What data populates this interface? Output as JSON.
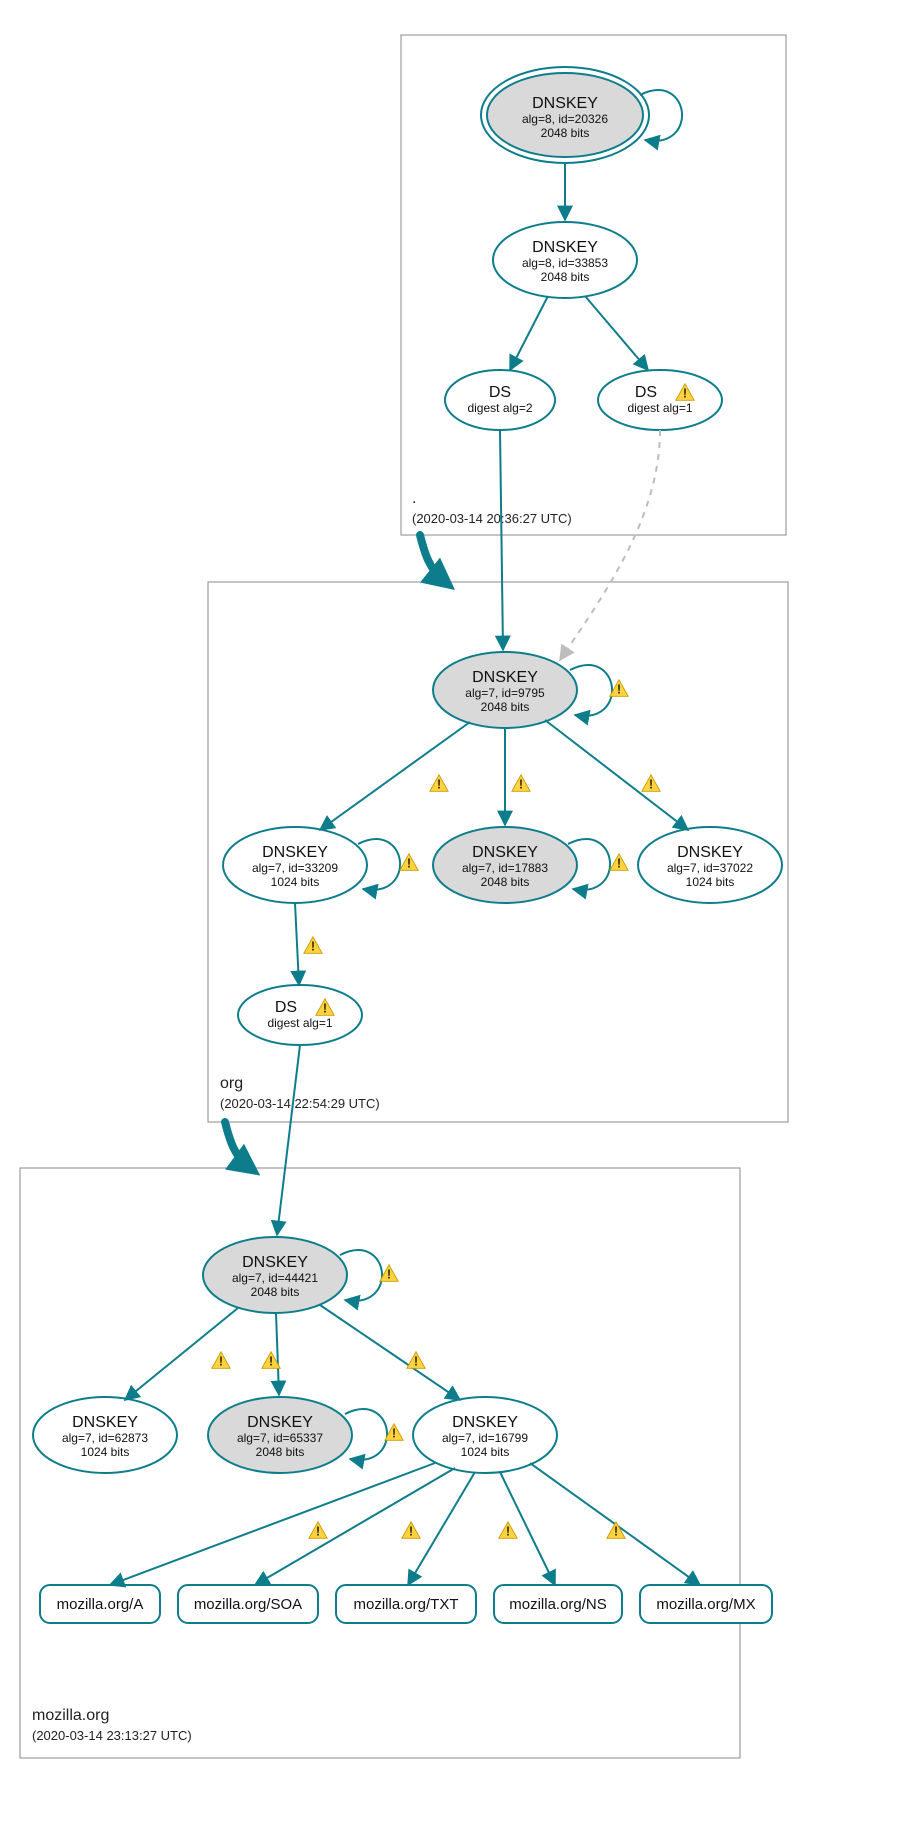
{
  "zones": {
    "root": {
      "name": ".",
      "timestamp": "(2020-03-14 20:36:27 UTC)"
    },
    "org": {
      "name": "org",
      "timestamp": "(2020-03-14 22:54:29 UTC)"
    },
    "mozilla": {
      "name": "mozilla.org",
      "timestamp": "(2020-03-14 23:13:27 UTC)"
    }
  },
  "nodes": {
    "root_ksk": {
      "title": "DNSKEY",
      "line2": "alg=8, id=20326",
      "line3": "2048 bits"
    },
    "root_zsk": {
      "title": "DNSKEY",
      "line2": "alg=8, id=33853",
      "line3": "2048 bits"
    },
    "root_ds2": {
      "title": "DS",
      "line2": "digest alg=2"
    },
    "root_ds1": {
      "title": "DS",
      "line2": "digest alg=1"
    },
    "org_ksk": {
      "title": "DNSKEY",
      "line2": "alg=7, id=9795",
      "line3": "2048 bits"
    },
    "org_k33209": {
      "title": "DNSKEY",
      "line2": "alg=7, id=33209",
      "line3": "1024 bits"
    },
    "org_k17883": {
      "title": "DNSKEY",
      "line2": "alg=7, id=17883",
      "line3": "2048 bits"
    },
    "org_k37022": {
      "title": "DNSKEY",
      "line2": "alg=7, id=37022",
      "line3": "1024 bits"
    },
    "org_ds1": {
      "title": "DS",
      "line2": "digest alg=1"
    },
    "moz_ksk": {
      "title": "DNSKEY",
      "line2": "alg=7, id=44421",
      "line3": "2048 bits"
    },
    "moz_k62873": {
      "title": "DNSKEY",
      "line2": "alg=7, id=62873",
      "line3": "1024 bits"
    },
    "moz_k65337": {
      "title": "DNSKEY",
      "line2": "alg=7, id=65337",
      "line3": "2048 bits"
    },
    "moz_k16799": {
      "title": "DNSKEY",
      "line2": "alg=7, id=16799",
      "line3": "1024 bits"
    }
  },
  "rrsets": {
    "a": {
      "label": "mozilla.org/A"
    },
    "soa": {
      "label": "mozilla.org/SOA"
    },
    "txt": {
      "label": "mozilla.org/TXT"
    },
    "ns": {
      "label": "mozilla.org/NS"
    },
    "mx": {
      "label": "mozilla.org/MX"
    }
  }
}
